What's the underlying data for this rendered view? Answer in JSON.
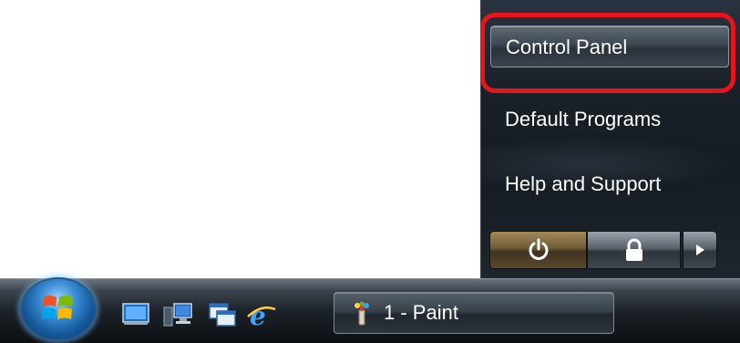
{
  "start_menu": {
    "items": [
      {
        "label": "Control Panel",
        "highlighted": true
      },
      {
        "label": "Default Programs"
      },
      {
        "label": "Help and Support"
      }
    ],
    "power_button_icon": "power-icon",
    "lock_button_icon": "lock-icon",
    "options_arrow_icon": "arrow-right-icon"
  },
  "taskbar": {
    "start_icon": "windows-logo-icon",
    "quick_launch": [
      "show-desktop-icon",
      "network-computer-icon",
      "switch-windows-icon",
      "internet-explorer-icon"
    ],
    "task_buttons": [
      {
        "label": "1 - Paint",
        "icon": "paint-icon"
      }
    ]
  },
  "colors": {
    "highlight_ring": "#e8141c",
    "menu_bg": "#1a2129",
    "taskbar_bg": "#1c2228",
    "text": "#ffffff"
  }
}
